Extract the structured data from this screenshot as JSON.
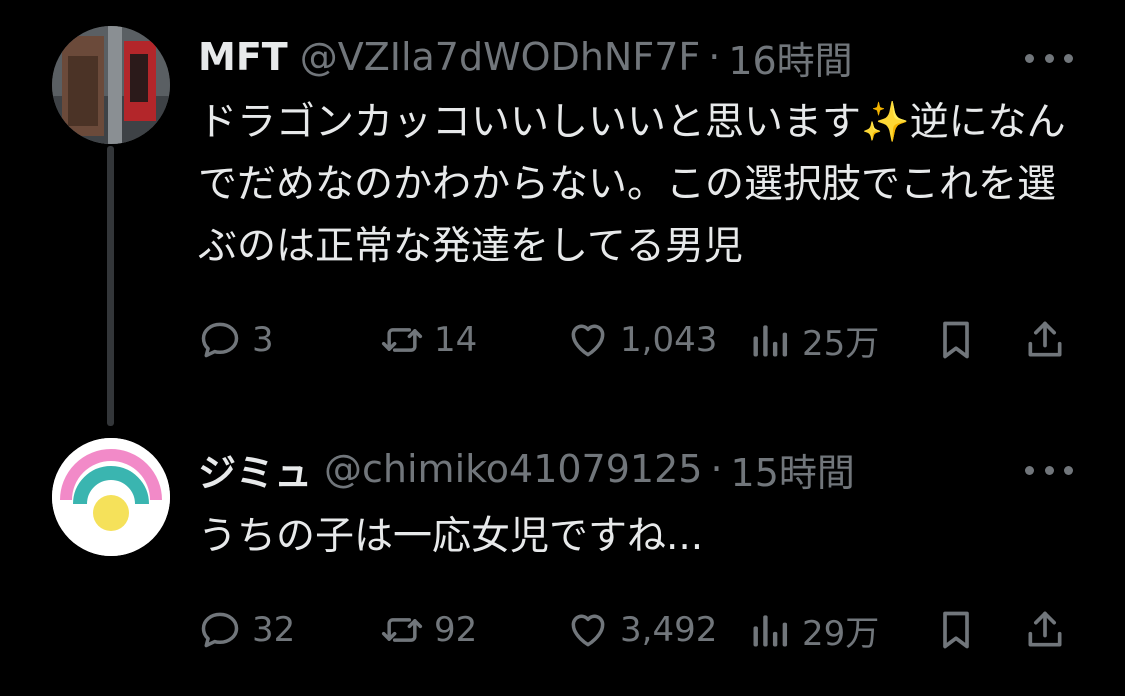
{
  "tweets": [
    {
      "display_name": "MFT",
      "handle": "@VZIla7dWODhNF7F",
      "dot": "·",
      "time": "16時間",
      "text_before_emoji": "ドラゴンカッコいいしいいと思います",
      "emoji": "✨",
      "text_after_emoji": "逆になんでだめなのかわからない。この選択肢でこれを選ぶのは正常な発達をしてる男児",
      "avatar_icon": "photo-avatar",
      "replies": "3",
      "reposts": "14",
      "likes": "1,043",
      "views": "25万"
    },
    {
      "display_name": "ジミュ",
      "handle": "@chimiko41079125",
      "dot": "·",
      "time": "15時間",
      "text": "うちの子は一応女児ですね...",
      "avatar_icon": "rainbow-avatar",
      "replies": "32",
      "reposts": "92",
      "likes": "3,492",
      "views": "29万"
    }
  ],
  "colors": {
    "background": "#000000",
    "text_primary": "#e7e9ea",
    "text_secondary": "#71767b",
    "thread_line": "#333639",
    "rainbow_pink": "#f28ac8",
    "rainbow_teal": "#3ab5b0",
    "sun_yellow": "#f5e15a"
  }
}
